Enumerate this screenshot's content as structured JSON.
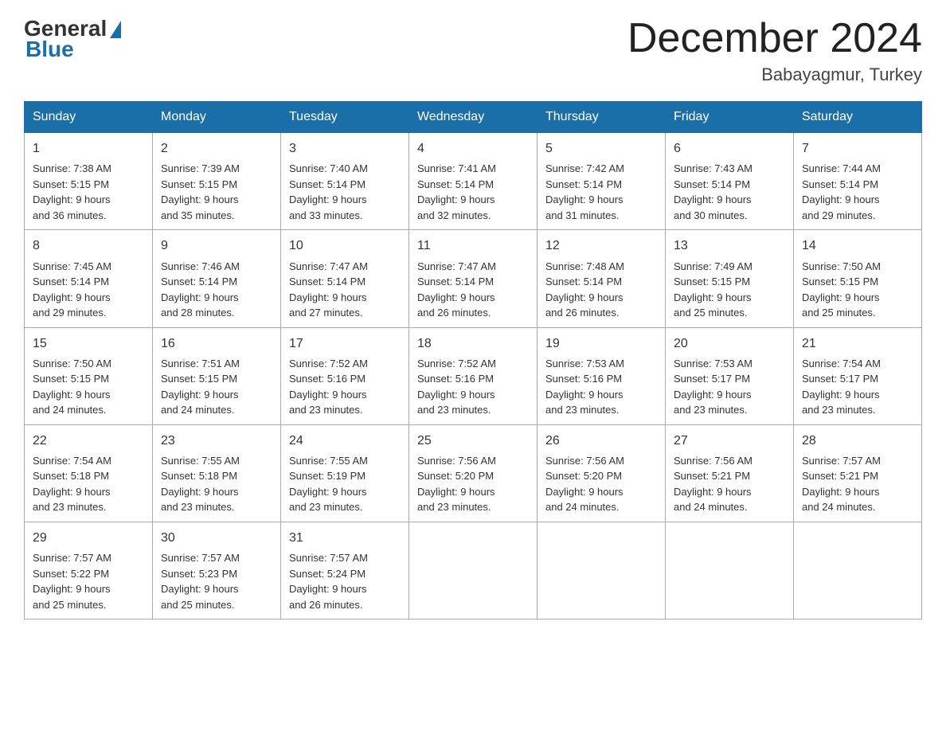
{
  "header": {
    "logo_general": "General",
    "logo_blue": "Blue",
    "month_title": "December 2024",
    "location": "Babayagmur, Turkey"
  },
  "days_of_week": [
    "Sunday",
    "Monday",
    "Tuesday",
    "Wednesday",
    "Thursday",
    "Friday",
    "Saturday"
  ],
  "weeks": [
    [
      {
        "day": "1",
        "sunrise": "7:38 AM",
        "sunset": "5:15 PM",
        "daylight": "9 hours and 36 minutes."
      },
      {
        "day": "2",
        "sunrise": "7:39 AM",
        "sunset": "5:15 PM",
        "daylight": "9 hours and 35 minutes."
      },
      {
        "day": "3",
        "sunrise": "7:40 AM",
        "sunset": "5:14 PM",
        "daylight": "9 hours and 33 minutes."
      },
      {
        "day": "4",
        "sunrise": "7:41 AM",
        "sunset": "5:14 PM",
        "daylight": "9 hours and 32 minutes."
      },
      {
        "day": "5",
        "sunrise": "7:42 AM",
        "sunset": "5:14 PM",
        "daylight": "9 hours and 31 minutes."
      },
      {
        "day": "6",
        "sunrise": "7:43 AM",
        "sunset": "5:14 PM",
        "daylight": "9 hours and 30 minutes."
      },
      {
        "day": "7",
        "sunrise": "7:44 AM",
        "sunset": "5:14 PM",
        "daylight": "9 hours and 29 minutes."
      }
    ],
    [
      {
        "day": "8",
        "sunrise": "7:45 AM",
        "sunset": "5:14 PM",
        "daylight": "9 hours and 29 minutes."
      },
      {
        "day": "9",
        "sunrise": "7:46 AM",
        "sunset": "5:14 PM",
        "daylight": "9 hours and 28 minutes."
      },
      {
        "day": "10",
        "sunrise": "7:47 AM",
        "sunset": "5:14 PM",
        "daylight": "9 hours and 27 minutes."
      },
      {
        "day": "11",
        "sunrise": "7:47 AM",
        "sunset": "5:14 PM",
        "daylight": "9 hours and 26 minutes."
      },
      {
        "day": "12",
        "sunrise": "7:48 AM",
        "sunset": "5:14 PM",
        "daylight": "9 hours and 26 minutes."
      },
      {
        "day": "13",
        "sunrise": "7:49 AM",
        "sunset": "5:15 PM",
        "daylight": "9 hours and 25 minutes."
      },
      {
        "day": "14",
        "sunrise": "7:50 AM",
        "sunset": "5:15 PM",
        "daylight": "9 hours and 25 minutes."
      }
    ],
    [
      {
        "day": "15",
        "sunrise": "7:50 AM",
        "sunset": "5:15 PM",
        "daylight": "9 hours and 24 minutes."
      },
      {
        "day": "16",
        "sunrise": "7:51 AM",
        "sunset": "5:15 PM",
        "daylight": "9 hours and 24 minutes."
      },
      {
        "day": "17",
        "sunrise": "7:52 AM",
        "sunset": "5:16 PM",
        "daylight": "9 hours and 23 minutes."
      },
      {
        "day": "18",
        "sunrise": "7:52 AM",
        "sunset": "5:16 PM",
        "daylight": "9 hours and 23 minutes."
      },
      {
        "day": "19",
        "sunrise": "7:53 AM",
        "sunset": "5:16 PM",
        "daylight": "9 hours and 23 minutes."
      },
      {
        "day": "20",
        "sunrise": "7:53 AM",
        "sunset": "5:17 PM",
        "daylight": "9 hours and 23 minutes."
      },
      {
        "day": "21",
        "sunrise": "7:54 AM",
        "sunset": "5:17 PM",
        "daylight": "9 hours and 23 minutes."
      }
    ],
    [
      {
        "day": "22",
        "sunrise": "7:54 AM",
        "sunset": "5:18 PM",
        "daylight": "9 hours and 23 minutes."
      },
      {
        "day": "23",
        "sunrise": "7:55 AM",
        "sunset": "5:18 PM",
        "daylight": "9 hours and 23 minutes."
      },
      {
        "day": "24",
        "sunrise": "7:55 AM",
        "sunset": "5:19 PM",
        "daylight": "9 hours and 23 minutes."
      },
      {
        "day": "25",
        "sunrise": "7:56 AM",
        "sunset": "5:20 PM",
        "daylight": "9 hours and 23 minutes."
      },
      {
        "day": "26",
        "sunrise": "7:56 AM",
        "sunset": "5:20 PM",
        "daylight": "9 hours and 24 minutes."
      },
      {
        "day": "27",
        "sunrise": "7:56 AM",
        "sunset": "5:21 PM",
        "daylight": "9 hours and 24 minutes."
      },
      {
        "day": "28",
        "sunrise": "7:57 AM",
        "sunset": "5:21 PM",
        "daylight": "9 hours and 24 minutes."
      }
    ],
    [
      {
        "day": "29",
        "sunrise": "7:57 AM",
        "sunset": "5:22 PM",
        "daylight": "9 hours and 25 minutes."
      },
      {
        "day": "30",
        "sunrise": "7:57 AM",
        "sunset": "5:23 PM",
        "daylight": "9 hours and 25 minutes."
      },
      {
        "day": "31",
        "sunrise": "7:57 AM",
        "sunset": "5:24 PM",
        "daylight": "9 hours and 26 minutes."
      },
      null,
      null,
      null,
      null
    ]
  ]
}
